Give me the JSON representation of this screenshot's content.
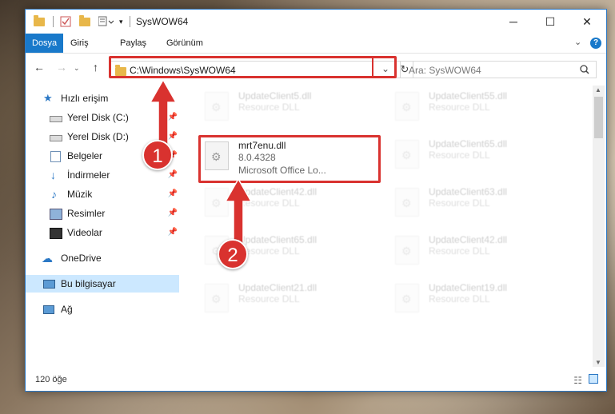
{
  "window": {
    "title": "SysWOW64",
    "controls": {
      "minimize": "─",
      "maximize": "☐",
      "close": "✕"
    }
  },
  "ribbon": {
    "tabs": [
      {
        "label": "Dosya",
        "active": true
      },
      {
        "label": "Giriş"
      },
      {
        "label": "Paylaş"
      },
      {
        "label": "Görünüm"
      }
    ],
    "expand_icon": "chevron-down-icon",
    "help_icon": "help-icon"
  },
  "address_bar": {
    "path": "C:\\Windows\\SysWOW64",
    "search_placeholder": "Ara: SysWOW64"
  },
  "sidebar": {
    "items": [
      {
        "label": "Hızlı erişim",
        "icon": "star-icon"
      },
      {
        "label": "Yerel Disk (C:)",
        "icon": "drive-icon",
        "pinned": true
      },
      {
        "label": "Yerel Disk (D:)",
        "icon": "drive-icon",
        "pinned": true
      },
      {
        "label": "Belgeler",
        "icon": "documents-icon",
        "pinned": true
      },
      {
        "label": "İndirmeler",
        "icon": "download-icon",
        "pinned": true
      },
      {
        "label": "Müzik",
        "icon": "music-icon",
        "pinned": true
      },
      {
        "label": "Resimler",
        "icon": "pictures-icon",
        "pinned": true
      },
      {
        "label": "Videolar",
        "icon": "video-icon",
        "pinned": true
      },
      {
        "label": "OneDrive",
        "icon": "cloud-icon"
      },
      {
        "label": "Bu bilgisayar",
        "icon": "computer-icon",
        "selected": true
      },
      {
        "label": "Ağ",
        "icon": "network-icon"
      }
    ]
  },
  "files": {
    "highlighted": {
      "name": "mrt7enu.dll",
      "version": "8.0.4328",
      "description": "Microsoft Office Lo..."
    },
    "others": [
      {
        "name": "UpdateClient5.dll",
        "type": "Resource DLL"
      },
      {
        "name": "UpdateClient55.dll",
        "type": "Resource DLL"
      },
      {
        "name": "UpdateClient65.dll",
        "type": "Resource DLL"
      },
      {
        "name": "UpdateClient42.dll",
        "type": "Resource DLL"
      },
      {
        "name": "UpdateClient63.dll",
        "type": "Resource DLL"
      },
      {
        "name": "UpdateClient65.dll",
        "type": "Resource DLL"
      },
      {
        "name": "UpdateClient42.dll",
        "type": "Resource DLL"
      },
      {
        "name": "UpdateClient21.dll",
        "type": "Resource DLL"
      },
      {
        "name": "UpdateClient19.dll",
        "type": "Resource DLL"
      }
    ]
  },
  "status": {
    "item_count": "120 öğe"
  },
  "annotations": {
    "step1": "1",
    "step2": "2",
    "color": "#d9322f"
  }
}
